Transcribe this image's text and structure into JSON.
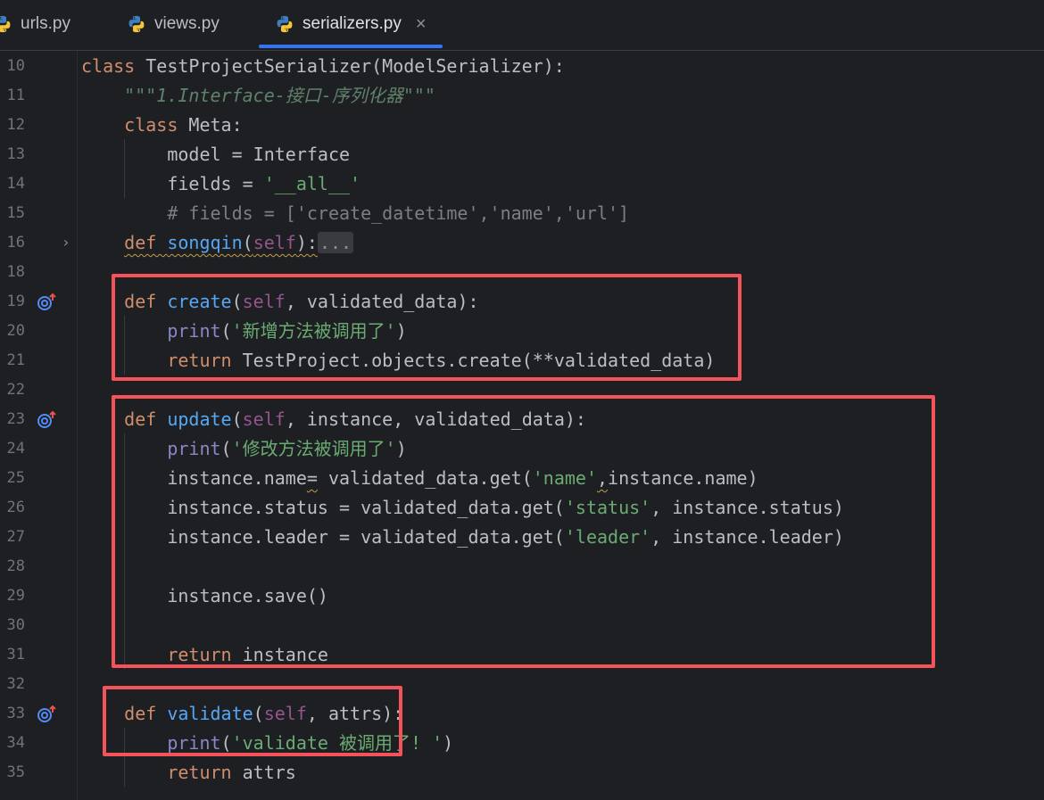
{
  "tabs": [
    {
      "name": "urls.py",
      "active": false
    },
    {
      "name": "views.py",
      "active": false
    },
    {
      "name": "serializers.py",
      "active": true,
      "close": "×"
    }
  ],
  "editor": {
    "lines": [
      {
        "n": "10",
        "tokens": [
          [
            "kw",
            "class "
          ],
          [
            "p",
            "TestProjectSerializer(ModelSerializer):"
          ]
        ]
      },
      {
        "n": "11",
        "tokens": [
          [
            "p",
            "    "
          ],
          [
            "doc",
            "\"\"\"1.Interface-接口-序列化器\"\"\""
          ]
        ]
      },
      {
        "n": "12",
        "tokens": [
          [
            "p",
            "    "
          ],
          [
            "kw",
            "class "
          ],
          [
            "p",
            "Meta:"
          ]
        ]
      },
      {
        "n": "13",
        "tokens": [
          [
            "p",
            "        model = Interface"
          ]
        ]
      },
      {
        "n": "14",
        "tokens": [
          [
            "p",
            "        fields = "
          ],
          [
            "str",
            "'__all__'"
          ]
        ]
      },
      {
        "n": "15",
        "tokens": [
          [
            "p",
            "        "
          ],
          [
            "cmt",
            "# fields = ['create_datetime','name','url']"
          ]
        ]
      },
      {
        "n": "16",
        "fold": true,
        "tokens": [
          [
            "p",
            "    "
          ],
          [
            "kw-wavy",
            "def "
          ],
          [
            "fn-wavy",
            "songqin"
          ],
          [
            "p-wavy",
            "("
          ],
          [
            "slf-wavy",
            "self"
          ],
          [
            "p-wavy",
            "):"
          ],
          [
            "ellip",
            "..."
          ]
        ]
      },
      {
        "n": "18",
        "tokens": []
      },
      {
        "n": "19",
        "icon": true,
        "tokens": [
          [
            "p",
            "    "
          ],
          [
            "kw",
            "def "
          ],
          [
            "fn",
            "create"
          ],
          [
            "p",
            "("
          ],
          [
            "slf",
            "self"
          ],
          [
            "p",
            ", validated_data):"
          ]
        ]
      },
      {
        "n": "20",
        "tokens": [
          [
            "p",
            "        "
          ],
          [
            "bi",
            "print"
          ],
          [
            "p",
            "("
          ],
          [
            "str",
            "'新增方法被调用了'"
          ],
          [
            "p",
            ")"
          ]
        ]
      },
      {
        "n": "21",
        "tokens": [
          [
            "p",
            "        "
          ],
          [
            "kw",
            "return "
          ],
          [
            "p",
            "TestProject.objects.create(**validated_data)"
          ]
        ]
      },
      {
        "n": "22",
        "tokens": []
      },
      {
        "n": "23",
        "icon": true,
        "tokens": [
          [
            "p",
            "    "
          ],
          [
            "kw",
            "def "
          ],
          [
            "fn",
            "update"
          ],
          [
            "p",
            "("
          ],
          [
            "slf",
            "self"
          ],
          [
            "p",
            ", instance, validated_data):"
          ]
        ]
      },
      {
        "n": "24",
        "tokens": [
          [
            "p",
            "        "
          ],
          [
            "bi",
            "print"
          ],
          [
            "p",
            "("
          ],
          [
            "str",
            "'修改方法被调用了'"
          ],
          [
            "p",
            ")"
          ]
        ]
      },
      {
        "n": "25",
        "tokens": [
          [
            "p",
            "        instance.name"
          ],
          [
            "p-wavy",
            "="
          ],
          [
            "p",
            " validated_data.get("
          ],
          [
            "str",
            "'name'"
          ],
          [
            "p-wavy",
            ","
          ],
          [
            "p",
            "instance.name)"
          ]
        ]
      },
      {
        "n": "26",
        "tokens": [
          [
            "p",
            "        instance.status = validated_data.get("
          ],
          [
            "str",
            "'status'"
          ],
          [
            "p",
            ", instance.status)"
          ]
        ]
      },
      {
        "n": "27",
        "tokens": [
          [
            "p",
            "        instance.leader = validated_data.get("
          ],
          [
            "str",
            "'leader'"
          ],
          [
            "p",
            ", instance.leader)"
          ]
        ]
      },
      {
        "n": "28",
        "tokens": []
      },
      {
        "n": "29",
        "tokens": [
          [
            "p",
            "        instance.save()"
          ]
        ]
      },
      {
        "n": "30",
        "tokens": []
      },
      {
        "n": "31",
        "tokens": [
          [
            "p",
            "        "
          ],
          [
            "kw",
            "return "
          ],
          [
            "p",
            "instance"
          ]
        ]
      },
      {
        "n": "32",
        "tokens": []
      },
      {
        "n": "33",
        "icon": true,
        "tokens": [
          [
            "p",
            "    "
          ],
          [
            "kw",
            "def "
          ],
          [
            "fn",
            "validate"
          ],
          [
            "p",
            "("
          ],
          [
            "slf",
            "self"
          ],
          [
            "p",
            ", attrs):"
          ]
        ]
      },
      {
        "n": "34",
        "tokens": [
          [
            "p",
            "        "
          ],
          [
            "bi",
            "print"
          ],
          [
            "p",
            "("
          ],
          [
            "str",
            "'validate 被调用了! '"
          ],
          [
            "p",
            ")"
          ]
        ]
      },
      {
        "n": "35",
        "tokens": [
          [
            "p",
            "        "
          ],
          [
            "kw",
            "return "
          ],
          [
            "p",
            "attrs"
          ]
        ]
      }
    ]
  },
  "colors": {
    "background": "#1e1f22",
    "keyword": "#cf8e6d",
    "function": "#56a8f5",
    "self": "#94558d",
    "string": "#6aab73",
    "comment": "#7a7e85",
    "docstring": "#5f826b",
    "builtin": "#8888c6",
    "highlight_box": "#f5535a",
    "tab_underline": "#3574f0"
  },
  "icons": {
    "tab": "python-file-icon",
    "gutter": "implements-override-icon",
    "fold": "chevron-right-icon"
  }
}
